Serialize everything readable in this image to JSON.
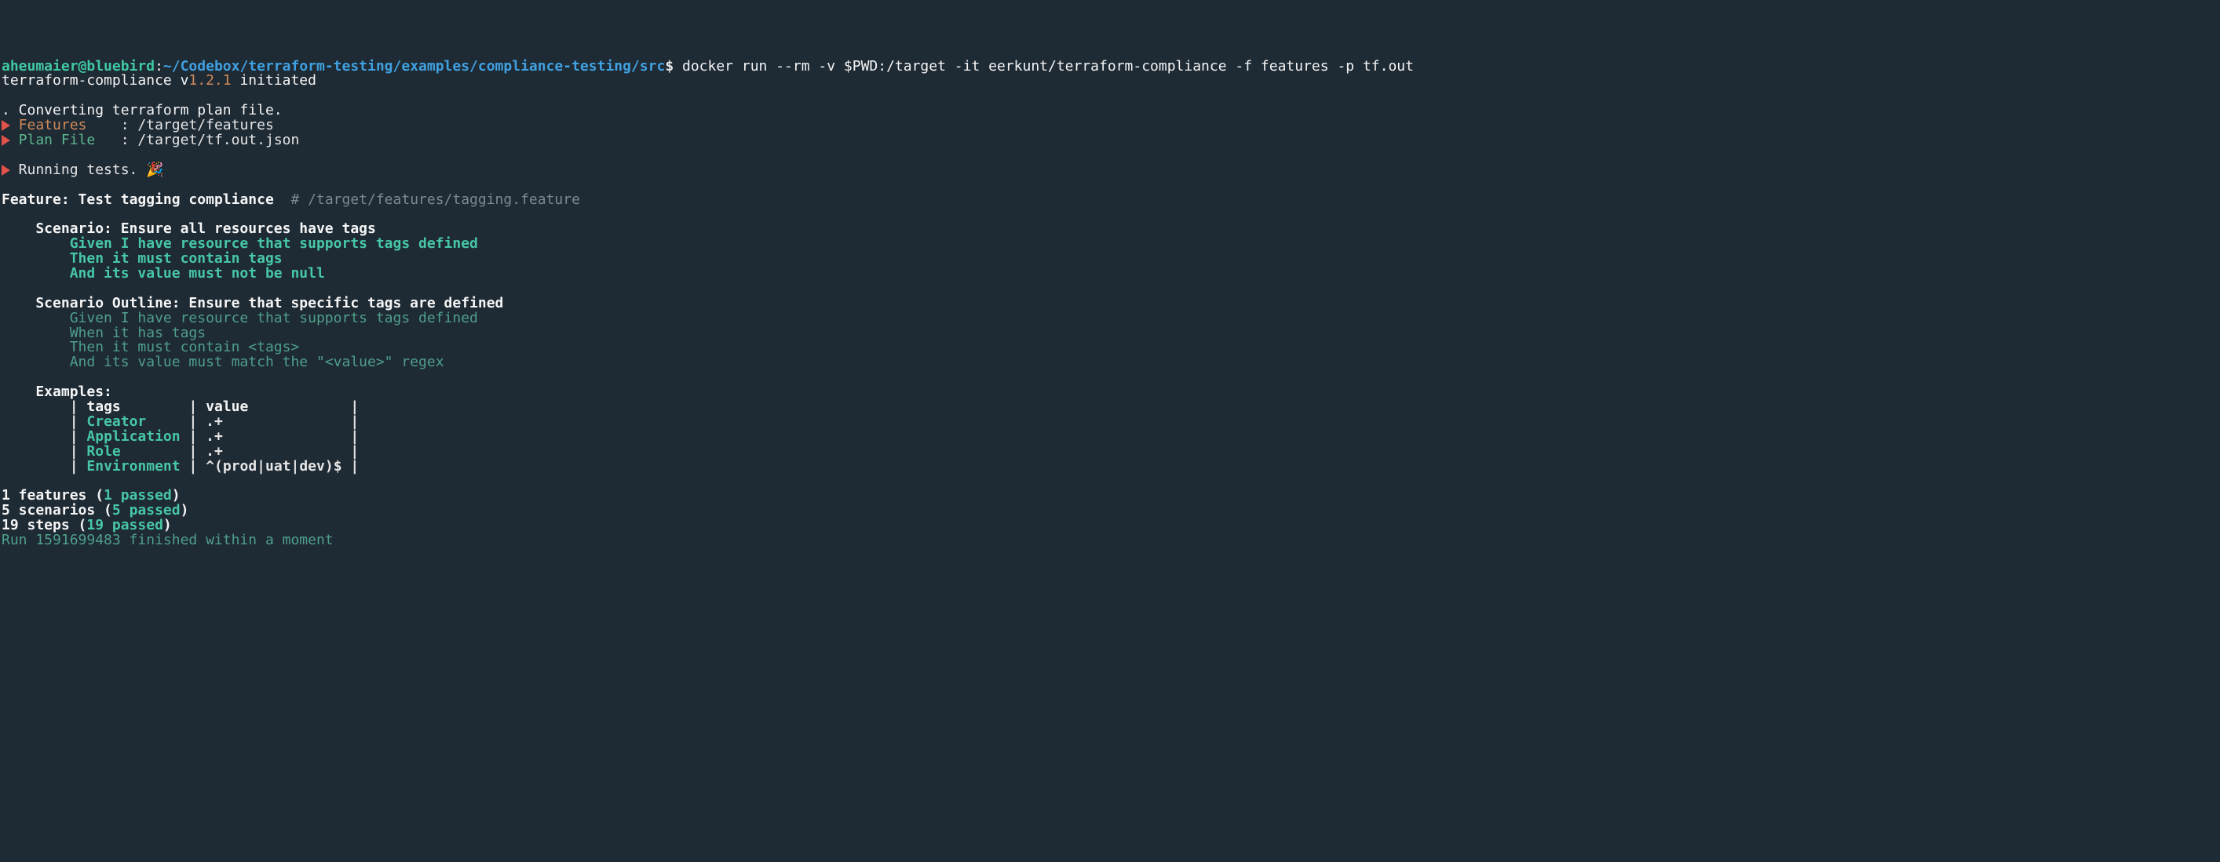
{
  "prompt": {
    "user": "aheumaier@bluebird",
    "colon": ":",
    "path": "~/Codebox/terraform-testing/examples/compliance-testing/src",
    "dollar": "$",
    "command": "docker run --rm -v $PWD:/target -it eerkunt/terraform-compliance -f features -p tf.out"
  },
  "init": {
    "app": "terraform-compliance v",
    "version": "1.2.1",
    "tail": " initiated"
  },
  "blank": "",
  "convert": ". Converting terraform plan file.",
  "features_line": {
    "label": "Features",
    "pad": "    ",
    "sep": ":",
    "value": "/target/features"
  },
  "plan_line": {
    "label": "Plan File",
    "pad": "   ",
    "sep": ":",
    "value": "/target/tf.out.json"
  },
  "running": "Running tests. 🎉",
  "feature_hdr": {
    "prefix": "Feature: ",
    "title": "Test tagging compliance",
    "comment": "  # /target/features/tagging.feature"
  },
  "scenario1": {
    "hdr": "    Scenario: Ensure all resources have tags",
    "s1": "        Given I have resource that supports tags defined",
    "s2": "        Then it must contain tags",
    "s3": "        And its value must not be null"
  },
  "scenario2": {
    "hdr": "    Scenario Outline: Ensure that specific tags are defined",
    "s1a": "        Given I have resource that supports tags defined",
    "s2a": "        When it has tags",
    "s3a_pre": "        Then it must contain ",
    "s3a_tag": "<tags>",
    "s4a_pre": "        And its value must match the \"",
    "s4a_mid": "<value>",
    "s4a_post": "\" regex"
  },
  "examples_hdr": "    Examples:",
  "table": {
    "header": {
      "c1": "tags       ",
      "c2": "value           "
    },
    "rows": [
      {
        "c1": "Creator    ",
        "c2": ".+              "
      },
      {
        "c1": "Application",
        "c2": ".+              "
      },
      {
        "c1": "Role       ",
        "c2": ".+              "
      },
      {
        "c1": "Environment",
        "c2": "^(prod|uat|dev)$"
      }
    ]
  },
  "summary": {
    "f_a": "1 features (",
    "f_b": "1 passed",
    "f_c": ")",
    "s_a": "5 scenarios (",
    "s_b": "5 passed",
    "s_c": ")",
    "t_a": "19 steps (",
    "t_b": "19 passed",
    "t_c": ")"
  },
  "finished": "Run 1591699483 finished within a moment"
}
